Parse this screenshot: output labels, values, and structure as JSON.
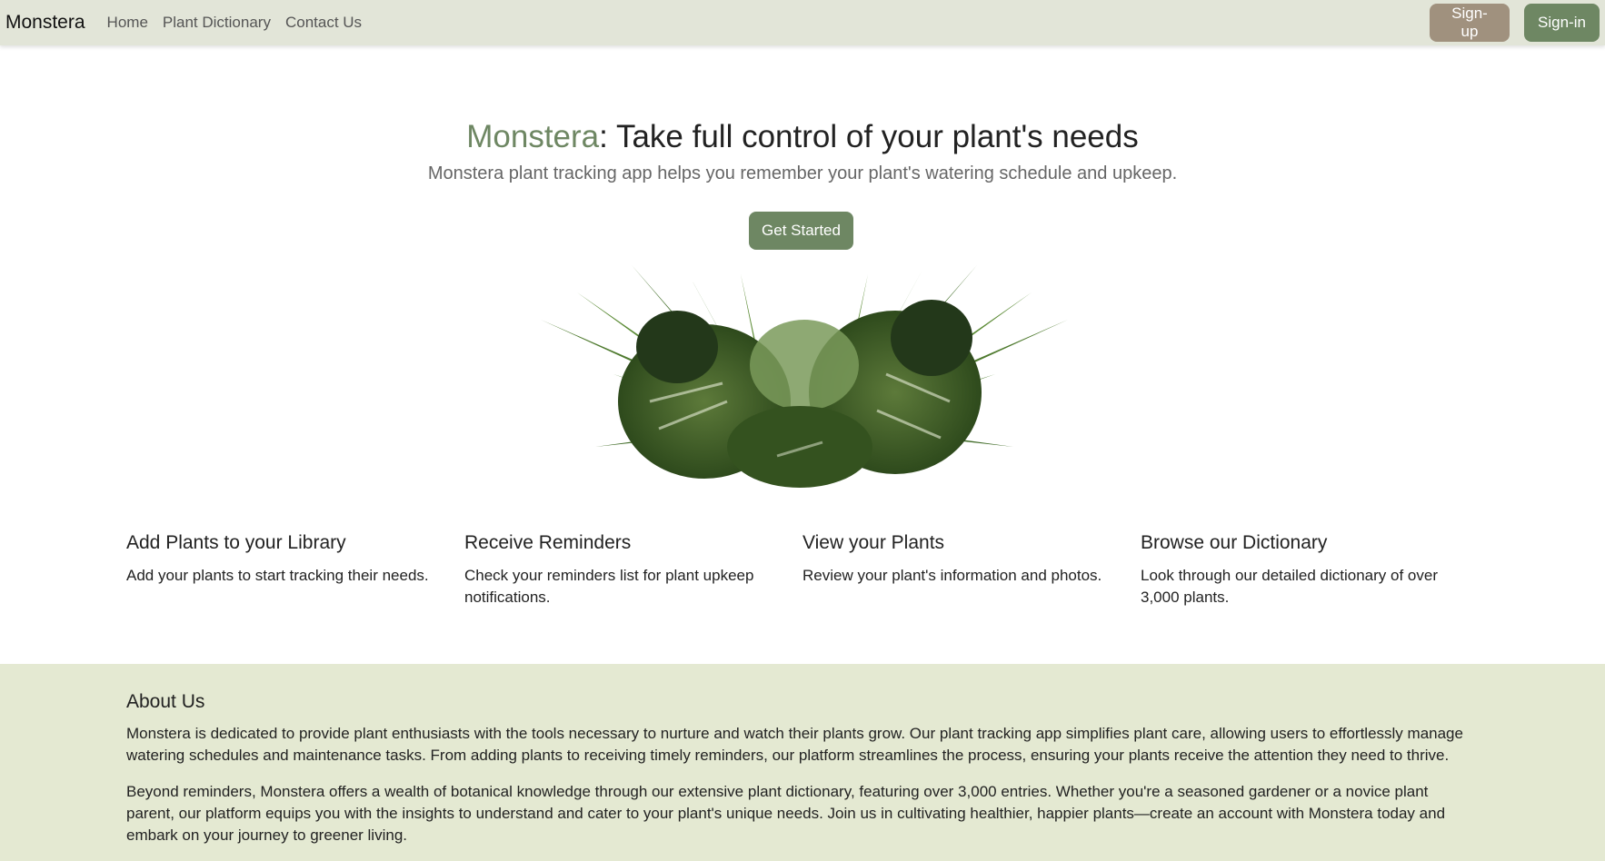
{
  "navbar": {
    "brand": "Monstera",
    "links": [
      "Home",
      "Plant Dictionary",
      "Contact Us"
    ],
    "signup_label": "Sign-up",
    "signin_label": "Sign-in"
  },
  "hero": {
    "title_accent": "Monstera",
    "title_rest": ": Take full control of your plant's needs",
    "subtitle": "Monstera plant tracking app helps you remember your plant's watering schedule and upkeep.",
    "cta_label": "Get Started",
    "image_icon": "monstera-leaves-illustration"
  },
  "features": [
    {
      "title": "Add Plants to your Library",
      "text": "Add your plants to start tracking their needs."
    },
    {
      "title": "Receive Reminders",
      "text": "Check your reminders list for plant upkeep notifications."
    },
    {
      "title": "View your Plants",
      "text": "Review your plant's information and photos."
    },
    {
      "title": "Browse our Dictionary",
      "text": "Look through our detailed dictionary of over 3,000 plants."
    }
  ],
  "about": {
    "title": "About Us",
    "paragraphs": [
      "Monstera is dedicated to provide plant enthusiasts with the tools necessary to nurture and watch their plants grow. Our plant tracking app simplifies plant care, allowing users to effortlessly manage watering schedules and maintenance tasks. From adding plants to receiving timely reminders, our platform streamlines the process, ensuring your plants receive the attention they need to thrive.",
      "Beyond reminders, Monstera offers a wealth of botanical knowledge through our extensive plant dictionary, featuring over 3,000 entries. Whether you're a seasoned gardener or a novice plant parent, our platform equips you with the insights to understand and cater to your plant's unique needs. Join us in cultivating healthier, happier plants—create an account with Monstera today and embark on your journey to greener living."
    ]
  },
  "colors": {
    "accent_green": "#6e8763",
    "signup_tan": "#a0917e",
    "navbar_bg": "#e2e5d8",
    "about_bg": "#e4e9d2"
  }
}
